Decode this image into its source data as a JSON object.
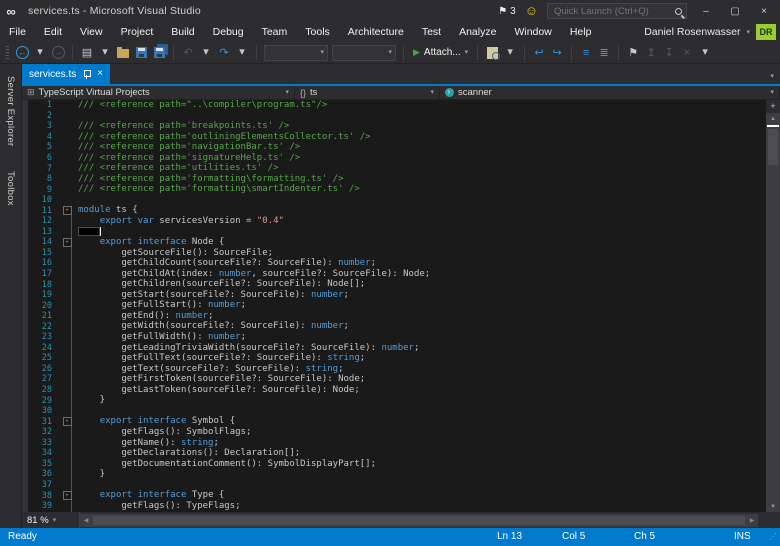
{
  "window": {
    "title": "services.ts - Microsoft Visual Studio",
    "notification_count": "3",
    "quick_launch_placeholder": "Quick Launch (Ctrl+Q)"
  },
  "menubar": {
    "items": [
      "File",
      "Edit",
      "View",
      "Project",
      "Build",
      "Debug",
      "Team",
      "Tools",
      "Architecture",
      "Test",
      "Analyze",
      "Window",
      "Help"
    ],
    "user_name": "Daniel Rosenwasser",
    "user_initials": "DR"
  },
  "toolbar": {
    "attach_label": "Attach..."
  },
  "sidebar": {
    "tabs": [
      "Server Explorer",
      "Toolbox"
    ]
  },
  "tab": {
    "label": "services.ts"
  },
  "navbar": {
    "project": "TypeScript Virtual Projects",
    "scope_prefix": "{}",
    "scope": "ts",
    "member": "scanner"
  },
  "icons": {
    "vs_logo": "∞",
    "flag": "⚑",
    "smiley": "☺",
    "minimize": "–",
    "maximize": "▢",
    "close": "×",
    "dropdown": "▾",
    "back_arrow": "←",
    "forward_arrow": "→",
    "new_file": "▤",
    "undo": "↶",
    "redo": "↷",
    "nav_return": "↩",
    "nav_goto": "↪",
    "indent_a": "≡",
    "indent_b": "≣",
    "bookmark": "⚑",
    "bookmark_prev": "↥",
    "bookmark_next": "↧",
    "grid": "⊞",
    "fold_minus": "-",
    "scroll_up": "▲",
    "scroll_down": "▼",
    "scroll_left": "◀",
    "scroll_right": "▶",
    "splitter": "+",
    "resize_grip": "⋰"
  },
  "editor": {
    "zoom_label": "81 %",
    "caret_line": 13,
    "lines": [
      {
        "n": 1,
        "tokens": [
          [
            "c",
            "/// <reference path=\"..\\compiler\\program.ts\"/>"
          ]
        ]
      },
      {
        "n": 2,
        "tokens": []
      },
      {
        "n": 3,
        "tokens": [
          [
            "c",
            "/// <reference path='breakpoints.ts' />"
          ]
        ]
      },
      {
        "n": 4,
        "tokens": [
          [
            "c",
            "/// <reference path='outliningElementsCollector.ts' />"
          ]
        ]
      },
      {
        "n": 5,
        "tokens": [
          [
            "c",
            "/// <reference path='navigationBar.ts' />"
          ]
        ]
      },
      {
        "n": 6,
        "tokens": [
          [
            "c",
            "/// <reference path='signatureHelp.ts' />"
          ]
        ]
      },
      {
        "n": 7,
        "tokens": [
          [
            "c",
            "/// <reference path='utilities.ts' />"
          ]
        ]
      },
      {
        "n": 8,
        "tokens": [
          [
            "c",
            "/// <reference path='formatting\\formatting.ts' />"
          ]
        ]
      },
      {
        "n": 9,
        "tokens": [
          [
            "c",
            "/// <reference path='formatting\\smartIndenter.ts' />"
          ]
        ]
      },
      {
        "n": 10,
        "tokens": []
      },
      {
        "n": 11,
        "fold": true,
        "tokens": [
          [
            "k",
            "module"
          ],
          [
            "p",
            " ts {"
          ]
        ]
      },
      {
        "n": 12,
        "tokens": [
          [
            "p",
            "    "
          ],
          [
            "k",
            "export"
          ],
          [
            "p",
            " "
          ],
          [
            "k",
            "var"
          ],
          [
            "p",
            " servicesVersion = "
          ],
          [
            "s",
            "\"0.4\""
          ]
        ]
      },
      {
        "n": 13,
        "caret": true,
        "tokens": []
      },
      {
        "n": 14,
        "fold": true,
        "tokens": [
          [
            "p",
            "    "
          ],
          [
            "k",
            "export"
          ],
          [
            "p",
            " "
          ],
          [
            "k",
            "interface"
          ],
          [
            "p",
            " Node {"
          ]
        ]
      },
      {
        "n": 15,
        "tokens": [
          [
            "p",
            "        getSourceFile(): SourceFile;"
          ]
        ]
      },
      {
        "n": 16,
        "tokens": [
          [
            "p",
            "        getChildCount(sourceFile?: SourceFile): "
          ],
          [
            "k",
            "number"
          ],
          [
            "p",
            ";"
          ]
        ]
      },
      {
        "n": 17,
        "tokens": [
          [
            "p",
            "        getChildAt(index: "
          ],
          [
            "k",
            "number"
          ],
          [
            "p",
            ", sourceFile?: SourceFile): Node;"
          ]
        ]
      },
      {
        "n": 18,
        "tokens": [
          [
            "p",
            "        getChildren(sourceFile?: SourceFile): Node[];"
          ]
        ]
      },
      {
        "n": 19,
        "tokens": [
          [
            "p",
            "        getStart(sourceFile?: SourceFile): "
          ],
          [
            "k",
            "number"
          ],
          [
            "p",
            ";"
          ]
        ]
      },
      {
        "n": 20,
        "tokens": [
          [
            "p",
            "        getFullStart(): "
          ],
          [
            "k",
            "number"
          ],
          [
            "p",
            ";"
          ]
        ]
      },
      {
        "n": 21,
        "tokens": [
          [
            "p",
            "        getEnd(): "
          ],
          [
            "k",
            "number"
          ],
          [
            "p",
            ";"
          ]
        ]
      },
      {
        "n": 22,
        "tokens": [
          [
            "p",
            "        getWidth(sourceFile?: SourceFile): "
          ],
          [
            "k",
            "number"
          ],
          [
            "p",
            ";"
          ]
        ]
      },
      {
        "n": 23,
        "tokens": [
          [
            "p",
            "        getFullWidth(): "
          ],
          [
            "k",
            "number"
          ],
          [
            "p",
            ";"
          ]
        ]
      },
      {
        "n": 24,
        "tokens": [
          [
            "p",
            "        getLeadingTriviaWidth(sourceFile?: SourceFile): "
          ],
          [
            "k",
            "number"
          ],
          [
            "p",
            ";"
          ]
        ]
      },
      {
        "n": 25,
        "tokens": [
          [
            "p",
            "        getFullText(sourceFile?: SourceFile): "
          ],
          [
            "k",
            "string"
          ],
          [
            "p",
            ";"
          ]
        ]
      },
      {
        "n": 26,
        "tokens": [
          [
            "p",
            "        getText(sourceFile?: SourceFile): "
          ],
          [
            "k",
            "string"
          ],
          [
            "p",
            ";"
          ]
        ]
      },
      {
        "n": 27,
        "tokens": [
          [
            "p",
            "        getFirstToken(sourceFile?: SourceFile): Node;"
          ]
        ]
      },
      {
        "n": 28,
        "tokens": [
          [
            "p",
            "        getLastToken(sourceFile?: SourceFile): Node;"
          ]
        ]
      },
      {
        "n": 29,
        "tokens": [
          [
            "p",
            "    }"
          ]
        ]
      },
      {
        "n": 30,
        "tokens": []
      },
      {
        "n": 31,
        "fold": true,
        "tokens": [
          [
            "p",
            "    "
          ],
          [
            "k",
            "export"
          ],
          [
            "p",
            " "
          ],
          [
            "k",
            "interface"
          ],
          [
            "p",
            " Symbol {"
          ]
        ]
      },
      {
        "n": 32,
        "tokens": [
          [
            "p",
            "        getFlags(): SymbolFlags;"
          ]
        ]
      },
      {
        "n": 33,
        "tokens": [
          [
            "p",
            "        getName(): "
          ],
          [
            "k",
            "string"
          ],
          [
            "p",
            ";"
          ]
        ]
      },
      {
        "n": 34,
        "tokens": [
          [
            "p",
            "        getDeclarations(): Declaration[];"
          ]
        ]
      },
      {
        "n": 35,
        "tokens": [
          [
            "p",
            "        getDocumentationComment(): SymbolDisplayPart[];"
          ]
        ]
      },
      {
        "n": 36,
        "tokens": [
          [
            "p",
            "    }"
          ]
        ]
      },
      {
        "n": 37,
        "tokens": []
      },
      {
        "n": 38,
        "fold": true,
        "tokens": [
          [
            "p",
            "    "
          ],
          [
            "k",
            "export"
          ],
          [
            "p",
            " "
          ],
          [
            "k",
            "interface"
          ],
          [
            "p",
            " Type {"
          ]
        ]
      },
      {
        "n": 39,
        "tokens": [
          [
            "p",
            "        getFlags(): TypeFlags;"
          ]
        ]
      }
    ]
  },
  "statusbar": {
    "message": "Ready",
    "line": "Ln 13",
    "column": "Col 5",
    "char": "Ch 5",
    "mode": "INS"
  },
  "colors": {
    "accent": "#007ACC",
    "comment": "#57A64A",
    "keyword": "#569CD6",
    "string": "#D69D85",
    "plain": "#C8C8C8",
    "line_number": "#2B91AF",
    "user_badge": "#9ACD32"
  }
}
